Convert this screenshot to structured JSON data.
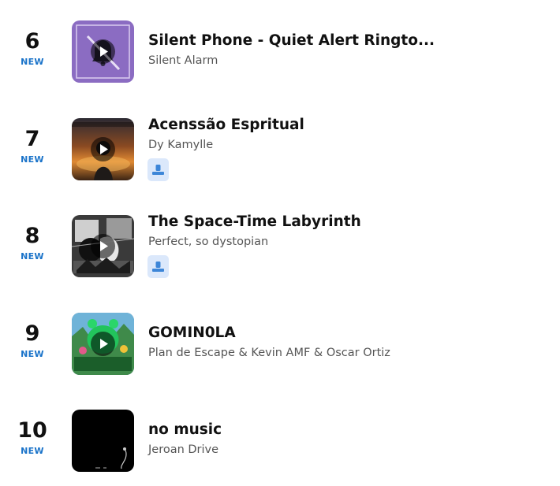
{
  "chart": {
    "items": [
      {
        "rank": "6",
        "badge": "NEW",
        "title": "Silent Phone - Quiet Alert Ringto...",
        "artist": "Silent Alarm",
        "has_user_icon": false,
        "art_icon": "muted-bell-artwork"
      },
      {
        "rank": "7",
        "badge": "NEW",
        "title": "Acenssão Espritual",
        "artist": "Dy Kamylle",
        "has_user_icon": true,
        "art_icon": "sunset-figure-artwork"
      },
      {
        "rank": "8",
        "badge": "NEW",
        "title": "The Space-Time Labyrinth",
        "artist": "Perfect, so dystopian",
        "has_user_icon": true,
        "art_icon": "monochrome-collage-artwork"
      },
      {
        "rank": "9",
        "badge": "NEW",
        "title": "GOMIN0LA",
        "artist": "Plan de Escape & Kevin AMF & Oscar Ortiz",
        "has_user_icon": false,
        "art_icon": "gominola-bear-artwork"
      },
      {
        "rank": "10",
        "badge": "NEW",
        "title": "no music",
        "artist": "Jeroan Drive",
        "has_user_icon": false,
        "art_icon": "black-artwork"
      }
    ]
  },
  "colors": {
    "badge": "#1a73c9",
    "user_chip_bg": "#dbe8fb",
    "user_chip_icon": "#3d86d8",
    "artist_text": "#555555"
  },
  "icons": {
    "play": "play-icon",
    "user": "user-profile-icon"
  }
}
